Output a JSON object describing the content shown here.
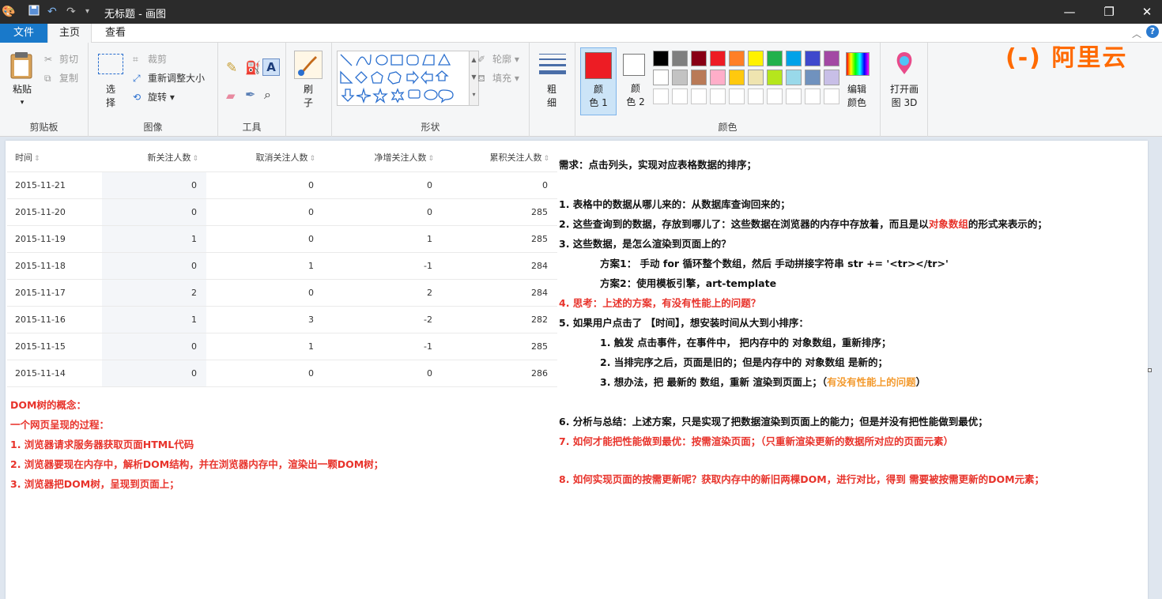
{
  "window": {
    "title": "无标题 - 画图",
    "minimize_glyph": "—",
    "maximize_glyph": "❐",
    "close_glyph": "✕"
  },
  "tabs": {
    "file": "文件",
    "home": "主页",
    "view": "查看"
  },
  "ribbon": {
    "clipboard": {
      "paste": "粘贴",
      "cut": "剪切",
      "copy": "复制",
      "label": "剪贴板"
    },
    "image": {
      "select": "选",
      "select2": "择",
      "crop": "裁剪",
      "resize": "重新调整大小",
      "rotate": "旋转",
      "label": "图像"
    },
    "tools": {
      "label": "工具"
    },
    "brushes": {
      "brush": "刷",
      "brush2": "子"
    },
    "shapes": {
      "outline": "轮廓",
      "fill": "填充",
      "label": "形状"
    },
    "size": {
      "label1": "粗",
      "label2": "细"
    },
    "colors": {
      "color1": "颜",
      "color1b": "色 1",
      "color2": "颜",
      "color2b": "色 2",
      "edit": "编辑",
      "edit2": "颜色",
      "label": "颜色",
      "palette_row1": [
        "#000000",
        "#7f7f7f",
        "#880015",
        "#ed1c24",
        "#ff7f27",
        "#fff200",
        "#22b14c",
        "#00a2e8",
        "#3f48cc",
        "#a349a4"
      ],
      "palette_row2": [
        "#ffffff",
        "#c3c3c3",
        "#b97a57",
        "#ffaec9",
        "#ffc90e",
        "#efe4b0",
        "#b5e61d",
        "#99d9ea",
        "#7092be",
        "#c8bfe7"
      ],
      "active_color1": "#ed1c24"
    },
    "paint3d": {
      "label": "打开画",
      "label2": "图 3D"
    }
  },
  "logo": {
    "text": "阿里云",
    "mark": "(-)"
  },
  "table": {
    "headers": [
      "时间",
      "新关注人数",
      "取消关注人数",
      "净增关注人数",
      "累积关注人数"
    ],
    "rows": [
      [
        "2015-11-21",
        "0",
        "0",
        "0",
        "0"
      ],
      [
        "2015-11-20",
        "0",
        "0",
        "0",
        "285"
      ],
      [
        "2015-11-19",
        "1",
        "0",
        "1",
        "285"
      ],
      [
        "2015-11-18",
        "0",
        "1",
        "-1",
        "284"
      ],
      [
        "2015-11-17",
        "2",
        "0",
        "2",
        "284"
      ],
      [
        "2015-11-16",
        "1",
        "3",
        "-2",
        "282"
      ],
      [
        "2015-11-15",
        "0",
        "1",
        "-1",
        "285"
      ],
      [
        "2015-11-14",
        "0",
        "0",
        "0",
        "286"
      ]
    ]
  },
  "notes_left": [
    "DOM树的概念：",
    "一个网页呈现的过程：",
    "1. 浏览器请求服务器获取页面HTML代码",
    "2. 浏览器要现在内存中，解析DOM结构，并在浏览器内存中，渲染出一颗DOM树；",
    "3. 浏览器把DOM树，呈现到页面上；"
  ],
  "notes_right": {
    "req": "需求：点击列头，实现对应表格数据的排序；",
    "n1": "1. 表格中的数据从哪儿来的：从数据库查询回来的；",
    "n2a": "2. 这些查询到的数据，存放到哪儿了：这些数据在浏览器的内存中存放着，而且是以",
    "n2b": "对象数组",
    "n2c": "的形式来表示的；",
    "n3": "3. 这些数据，是怎么渲染到页面上的？",
    "plan1": "方案1： 手动 for 循环整个数组，然后 手动拼接字符串 str += '<tr></tr>'",
    "plan2": "方案2：使用模板引擎，art-template",
    "n4": "4. 思考：上述的方案，有没有性能上的问题？",
    "n5": "5. 如果用户点击了 【时间】，想安装时间从大到小排序：",
    "s1": "1. 触发 点击事件，在事件中， 把内存中的 对象数组，重新排序；",
    "s2": "2. 当排完序之后，页面是旧的；但是内存中的 对象数组 是新的；",
    "s3a": "3. 想办法，把 最新的 数组，重新 渲染到页面上；（",
    "s3b": "有没有性能上的问题",
    "s3c": "）",
    "n6": "6. 分析与总结：上述方案，只是实现了把数据渲染到页面上的能力；但是并没有把性能做到最优；",
    "n7": "7. 如何才能把性能做到最优：按需渲染页面；（只重新渲染更新的数据所对应的页面元素）",
    "n8": "8. 如何实现页面的按需更新呢？获取内存中的新旧两棵DOM，进行对比，得到 需要被按需更新的DOM元素；"
  }
}
